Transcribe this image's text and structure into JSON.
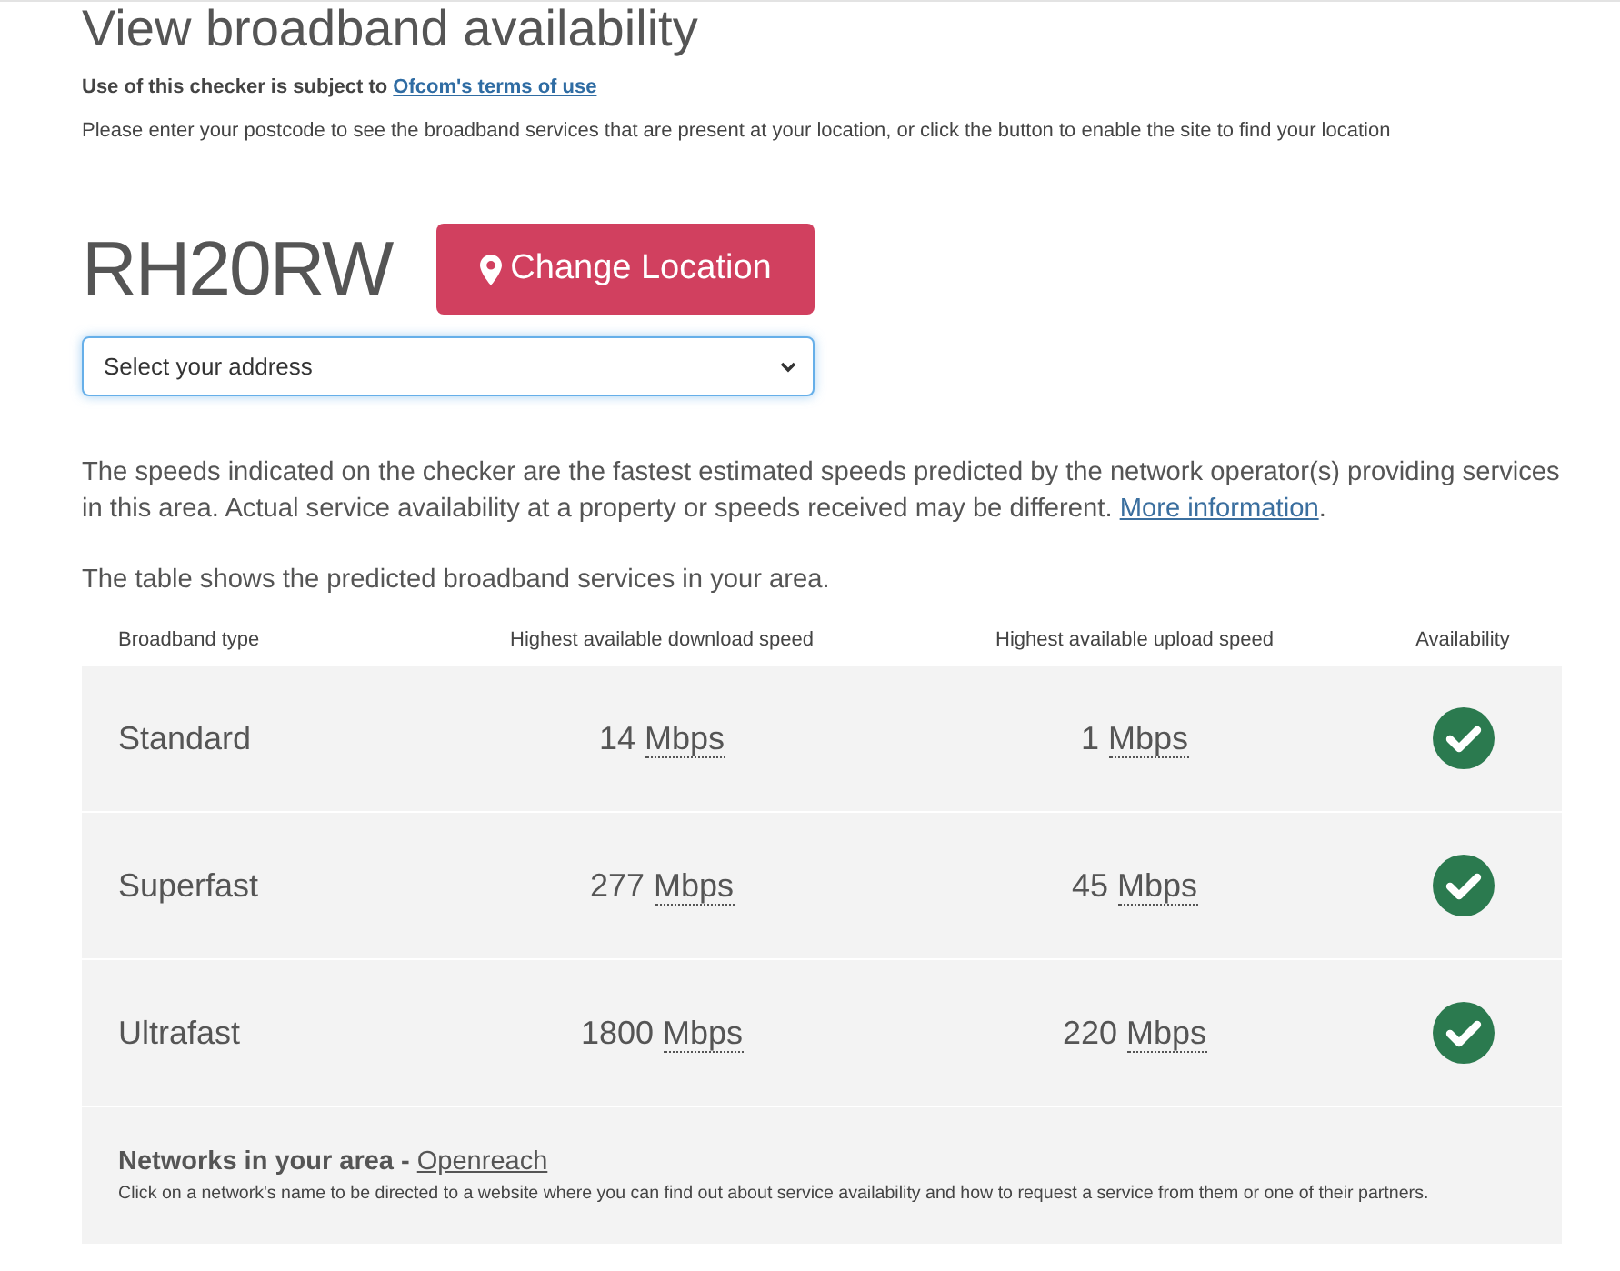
{
  "title": "View broadband availability",
  "terms": {
    "text": "Use of this checker is subject to",
    "link": "Ofcom's terms of use"
  },
  "instructions": "Please enter your postcode to see the broadband services that are present at your location, or click the button to enable the site to find your location",
  "location": {
    "postcode": "RH20RW",
    "button": "Change Location",
    "address_select": {
      "value": "Select your address"
    }
  },
  "disclaimer": {
    "text": "The speeds indicated on the checker are the fastest estimated speeds predicted by the network operator(s) providing services in this area. Actual service availability at a property or speeds received may be different.",
    "link": "More information",
    "end": "."
  },
  "table_intro": "The table shows the predicted broadband services in your area.",
  "table": {
    "columns": [
      "Broadband type",
      "Highest available download speed",
      "Highest available upload speed",
      "Availability"
    ],
    "rows": [
      {
        "type": "Standard",
        "download": {
          "value": "14",
          "unit": "Mbps"
        },
        "upload": {
          "value": "1",
          "unit": "Mbps"
        },
        "available": true
      },
      {
        "type": "Superfast",
        "download": {
          "value": "277",
          "unit": "Mbps"
        },
        "upload": {
          "value": "45",
          "unit": "Mbps"
        },
        "available": true
      },
      {
        "type": "Ultrafast",
        "download": {
          "value": "1800",
          "unit": "Mbps"
        },
        "upload": {
          "value": "220",
          "unit": "Mbps"
        },
        "available": true
      }
    ],
    "networks": {
      "label": "Networks in your area -",
      "links": [
        "Openreach"
      ],
      "note": "Click on a network's name to be directed to a website where you can find out about service availability and how to request a service from them or one of their partners."
    }
  }
}
